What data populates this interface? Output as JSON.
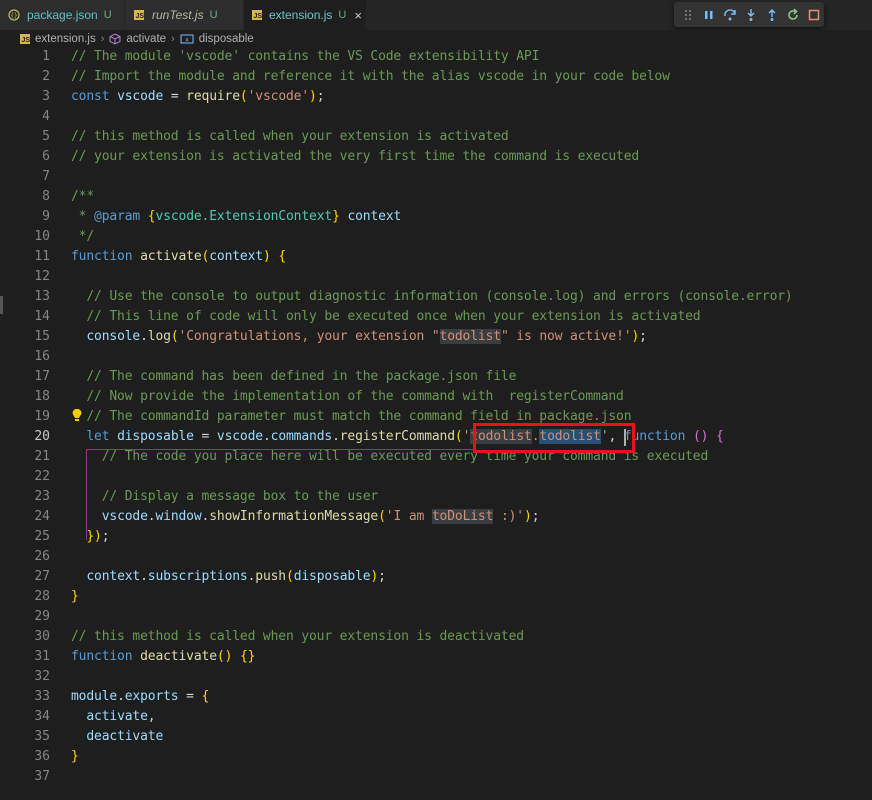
{
  "tabs": [
    {
      "name": "package.json",
      "status": "U",
      "icon": "json-file-icon",
      "active": false,
      "italic": false
    },
    {
      "name": "runTest.js",
      "status": "U",
      "icon": "js-file-icon",
      "active": false,
      "italic": true
    },
    {
      "name": "extension.js",
      "status": "U",
      "icon": "js-file-icon",
      "active": true,
      "italic": false
    }
  ],
  "tab_close_glyph": "×",
  "breadcrumb": {
    "file": "extension.js",
    "symbol1": "activate",
    "symbol2": "disposable"
  },
  "debug_toolbar": [
    "drag-handle-icon",
    "pause-icon",
    "step-over-icon",
    "step-into-icon",
    "step-out-icon",
    "restart-icon",
    "stop-icon"
  ],
  "lines": [
    "// The module 'vscode' contains the VS Code extensibility API",
    "// Import the module and reference it with the alias vscode in your code below",
    "const vscode = require('vscode');",
    "",
    "// this method is called when your extension is activated",
    "// your extension is activated the very first time the command is executed",
    "",
    "/**",
    " * @param {vscode.ExtensionContext} context",
    " */",
    "function activate(context) {",
    "",
    "  // Use the console to output diagnostic information (console.log) and errors (console.error)",
    "  // This line of code will only be executed once when your extension is activated",
    "  console.log('Congratulations, your extension \"todolist\" is now active!');",
    "",
    "  // The command has been defined in the package.json file",
    "  // Now provide the implementation of the command with  registerCommand",
    "  // The commandId parameter must match the command field in package.json",
    "  let disposable = vscode.commands.registerCommand('todolist.todolist', function () {",
    "    // The code you place here will be executed every time your command is executed",
    "",
    "    // Display a message box to the user",
    "    vscode.window.showInformationMessage('I am toDoList :)');",
    "  });",
    "",
    "  context.subscriptions.push(disposable);",
    "}",
    "",
    "// this method is called when your extension is deactivated",
    "function deactivate() {}",
    "",
    "module.exports = {",
    "  activate,",
    "  deactivate",
    "}",
    ""
  ],
  "current_line": 20,
  "colors": {
    "background": "#1e1e1e",
    "comment": "#6a9955",
    "keyword": "#569cd6",
    "function": "#dcdcaa",
    "string": "#ce9178",
    "variable": "#9cdcfe",
    "highlight_box": "#e8121c"
  }
}
